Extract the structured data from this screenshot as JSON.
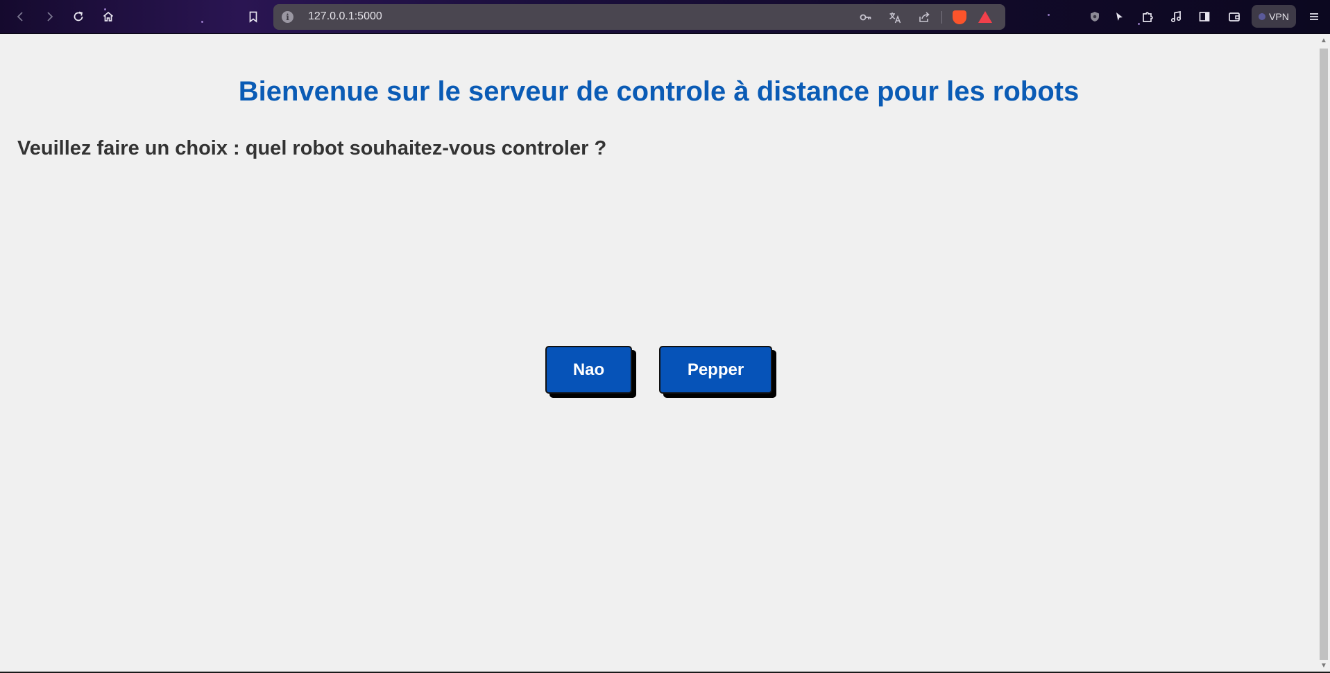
{
  "browser": {
    "url": "127.0.0.1:5000",
    "info_glyph": "i",
    "vpn_label": "VPN",
    "icons": {
      "back": "back-arrow-icon",
      "forward": "forward-arrow-icon",
      "reload": "reload-icon",
      "home": "home-icon",
      "bookmark": "bookmark-icon",
      "password": "key-icon",
      "translate": "translate-icon",
      "share": "share-icon",
      "brave_shields": "brave-lion-icon",
      "brave_rewards": "brave-rewards-icon",
      "extension_shield": "shield-icon",
      "cursor": "cursor-icon",
      "extensions": "puzzle-icon",
      "media": "music-note-icon",
      "sidebar": "sidebar-icon",
      "wallet": "wallet-icon",
      "menu": "hamburger-menu-icon"
    },
    "colors": {
      "brave_orange": "#fb542b",
      "rewards_red": "#f1404b"
    }
  },
  "page": {
    "title": "Bienvenue sur le serveur de controle à distance pour les robots",
    "subtitle": "Veuillez faire un choix : quel robot souhaitez-vous controler ?",
    "buttons": [
      {
        "label": "Nao"
      },
      {
        "label": "Pepper"
      }
    ],
    "colors": {
      "title": "#0a5bb5",
      "button_bg": "#0653b8",
      "button_text": "#ffffff",
      "background": "#f0f0f0"
    }
  }
}
